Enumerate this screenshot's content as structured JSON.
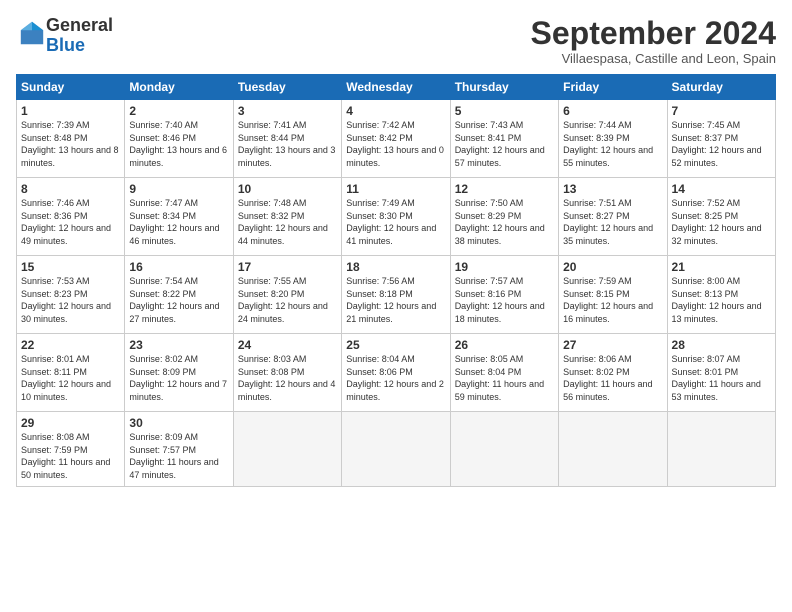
{
  "header": {
    "logo_general": "General",
    "logo_blue": "Blue",
    "month": "September 2024",
    "location": "Villaespasa, Castille and Leon, Spain"
  },
  "weekdays": [
    "Sunday",
    "Monday",
    "Tuesday",
    "Wednesday",
    "Thursday",
    "Friday",
    "Saturday"
  ],
  "weeks": [
    [
      {
        "day": "1",
        "sunrise": "Sunrise: 7:39 AM",
        "sunset": "Sunset: 8:48 PM",
        "daylight": "Daylight: 13 hours and 8 minutes."
      },
      {
        "day": "2",
        "sunrise": "Sunrise: 7:40 AM",
        "sunset": "Sunset: 8:46 PM",
        "daylight": "Daylight: 13 hours and 6 minutes."
      },
      {
        "day": "3",
        "sunrise": "Sunrise: 7:41 AM",
        "sunset": "Sunset: 8:44 PM",
        "daylight": "Daylight: 13 hours and 3 minutes."
      },
      {
        "day": "4",
        "sunrise": "Sunrise: 7:42 AM",
        "sunset": "Sunset: 8:42 PM",
        "daylight": "Daylight: 13 hours and 0 minutes."
      },
      {
        "day": "5",
        "sunrise": "Sunrise: 7:43 AM",
        "sunset": "Sunset: 8:41 PM",
        "daylight": "Daylight: 12 hours and 57 minutes."
      },
      {
        "day": "6",
        "sunrise": "Sunrise: 7:44 AM",
        "sunset": "Sunset: 8:39 PM",
        "daylight": "Daylight: 12 hours and 55 minutes."
      },
      {
        "day": "7",
        "sunrise": "Sunrise: 7:45 AM",
        "sunset": "Sunset: 8:37 PM",
        "daylight": "Daylight: 12 hours and 52 minutes."
      }
    ],
    [
      {
        "day": "8",
        "sunrise": "Sunrise: 7:46 AM",
        "sunset": "Sunset: 8:36 PM",
        "daylight": "Daylight: 12 hours and 49 minutes."
      },
      {
        "day": "9",
        "sunrise": "Sunrise: 7:47 AM",
        "sunset": "Sunset: 8:34 PM",
        "daylight": "Daylight: 12 hours and 46 minutes."
      },
      {
        "day": "10",
        "sunrise": "Sunrise: 7:48 AM",
        "sunset": "Sunset: 8:32 PM",
        "daylight": "Daylight: 12 hours and 44 minutes."
      },
      {
        "day": "11",
        "sunrise": "Sunrise: 7:49 AM",
        "sunset": "Sunset: 8:30 PM",
        "daylight": "Daylight: 12 hours and 41 minutes."
      },
      {
        "day": "12",
        "sunrise": "Sunrise: 7:50 AM",
        "sunset": "Sunset: 8:29 PM",
        "daylight": "Daylight: 12 hours and 38 minutes."
      },
      {
        "day": "13",
        "sunrise": "Sunrise: 7:51 AM",
        "sunset": "Sunset: 8:27 PM",
        "daylight": "Daylight: 12 hours and 35 minutes."
      },
      {
        "day": "14",
        "sunrise": "Sunrise: 7:52 AM",
        "sunset": "Sunset: 8:25 PM",
        "daylight": "Daylight: 12 hours and 32 minutes."
      }
    ],
    [
      {
        "day": "15",
        "sunrise": "Sunrise: 7:53 AM",
        "sunset": "Sunset: 8:23 PM",
        "daylight": "Daylight: 12 hours and 30 minutes."
      },
      {
        "day": "16",
        "sunrise": "Sunrise: 7:54 AM",
        "sunset": "Sunset: 8:22 PM",
        "daylight": "Daylight: 12 hours and 27 minutes."
      },
      {
        "day": "17",
        "sunrise": "Sunrise: 7:55 AM",
        "sunset": "Sunset: 8:20 PM",
        "daylight": "Daylight: 12 hours and 24 minutes."
      },
      {
        "day": "18",
        "sunrise": "Sunrise: 7:56 AM",
        "sunset": "Sunset: 8:18 PM",
        "daylight": "Daylight: 12 hours and 21 minutes."
      },
      {
        "day": "19",
        "sunrise": "Sunrise: 7:57 AM",
        "sunset": "Sunset: 8:16 PM",
        "daylight": "Daylight: 12 hours and 18 minutes."
      },
      {
        "day": "20",
        "sunrise": "Sunrise: 7:59 AM",
        "sunset": "Sunset: 8:15 PM",
        "daylight": "Daylight: 12 hours and 16 minutes."
      },
      {
        "day": "21",
        "sunrise": "Sunrise: 8:00 AM",
        "sunset": "Sunset: 8:13 PM",
        "daylight": "Daylight: 12 hours and 13 minutes."
      }
    ],
    [
      {
        "day": "22",
        "sunrise": "Sunrise: 8:01 AM",
        "sunset": "Sunset: 8:11 PM",
        "daylight": "Daylight: 12 hours and 10 minutes."
      },
      {
        "day": "23",
        "sunrise": "Sunrise: 8:02 AM",
        "sunset": "Sunset: 8:09 PM",
        "daylight": "Daylight: 12 hours and 7 minutes."
      },
      {
        "day": "24",
        "sunrise": "Sunrise: 8:03 AM",
        "sunset": "Sunset: 8:08 PM",
        "daylight": "Daylight: 12 hours and 4 minutes."
      },
      {
        "day": "25",
        "sunrise": "Sunrise: 8:04 AM",
        "sunset": "Sunset: 8:06 PM",
        "daylight": "Daylight: 12 hours and 2 minutes."
      },
      {
        "day": "26",
        "sunrise": "Sunrise: 8:05 AM",
        "sunset": "Sunset: 8:04 PM",
        "daylight": "Daylight: 11 hours and 59 minutes."
      },
      {
        "day": "27",
        "sunrise": "Sunrise: 8:06 AM",
        "sunset": "Sunset: 8:02 PM",
        "daylight": "Daylight: 11 hours and 56 minutes."
      },
      {
        "day": "28",
        "sunrise": "Sunrise: 8:07 AM",
        "sunset": "Sunset: 8:01 PM",
        "daylight": "Daylight: 11 hours and 53 minutes."
      }
    ],
    [
      {
        "day": "29",
        "sunrise": "Sunrise: 8:08 AM",
        "sunset": "Sunset: 7:59 PM",
        "daylight": "Daylight: 11 hours and 50 minutes."
      },
      {
        "day": "30",
        "sunrise": "Sunrise: 8:09 AM",
        "sunset": "Sunset: 7:57 PM",
        "daylight": "Daylight: 11 hours and 47 minutes."
      },
      null,
      null,
      null,
      null,
      null
    ]
  ]
}
